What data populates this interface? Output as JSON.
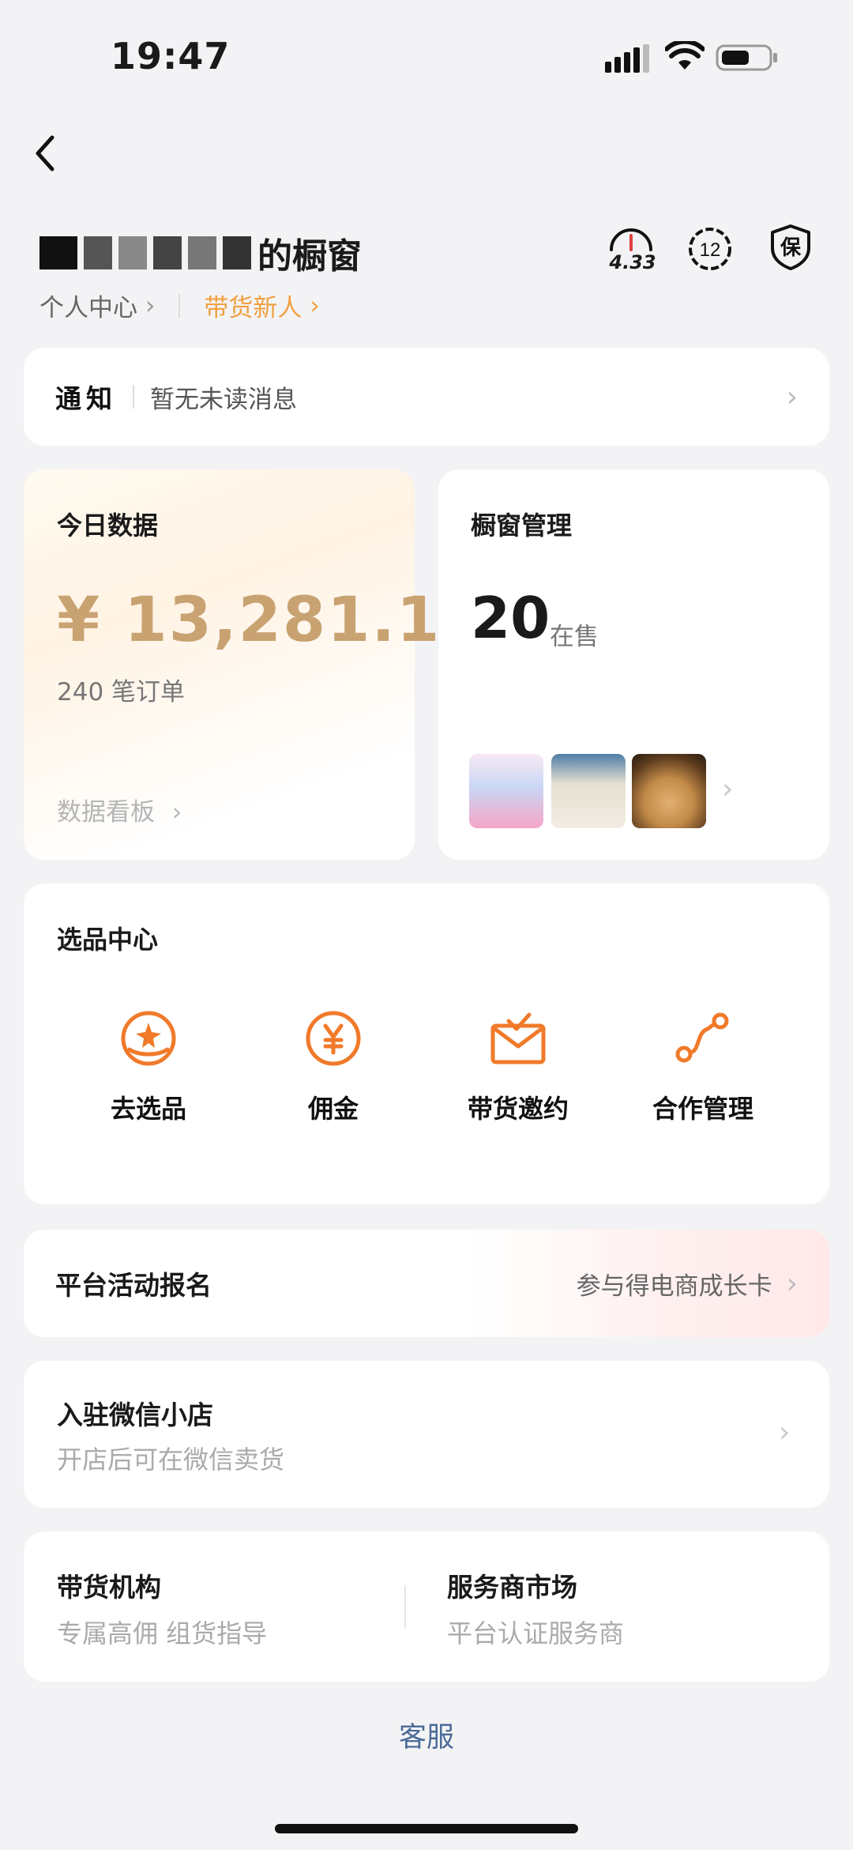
{
  "status_bar": {
    "time": "19:47"
  },
  "header": {
    "shop_name_suffix": "的橱窗",
    "personal_center": "个人中心",
    "tag": "带货新人",
    "score": "4.33",
    "level": "12",
    "bao": "保"
  },
  "notice": {
    "title": "通知",
    "text": "暂无未读消息"
  },
  "today": {
    "title": "今日数据",
    "amount": "¥ 13,281.1",
    "orders": "240 笔订单",
    "board": "数据看板"
  },
  "window": {
    "title": "橱窗管理",
    "count": "20",
    "label": "在售"
  },
  "select_center": {
    "title": "选品中心",
    "tools": [
      {
        "label": "去选品",
        "icon": "select-product-icon"
      },
      {
        "label": "佣金",
        "icon": "commission-icon"
      },
      {
        "label": "带货邀约",
        "icon": "invite-icon"
      },
      {
        "label": "合作管理",
        "icon": "cooperation-icon"
      }
    ]
  },
  "activity": {
    "title": "平台活动报名",
    "right": "参与得电商成长卡"
  },
  "wechat_shop": {
    "title": "入驻微信小店",
    "sub": "开店后可在微信卖货"
  },
  "bottom": {
    "left_title": "带货机构",
    "left_sub": "专属高佣 组货指导",
    "right_title": "服务商市场",
    "right_sub": "平台认证服务商"
  },
  "service": "客服",
  "colors": {
    "accent_gold": "#c9a272",
    "tag_orange": "#f0a040",
    "icon_orange": "#f07a2a",
    "link_blue": "#4a6a98"
  }
}
